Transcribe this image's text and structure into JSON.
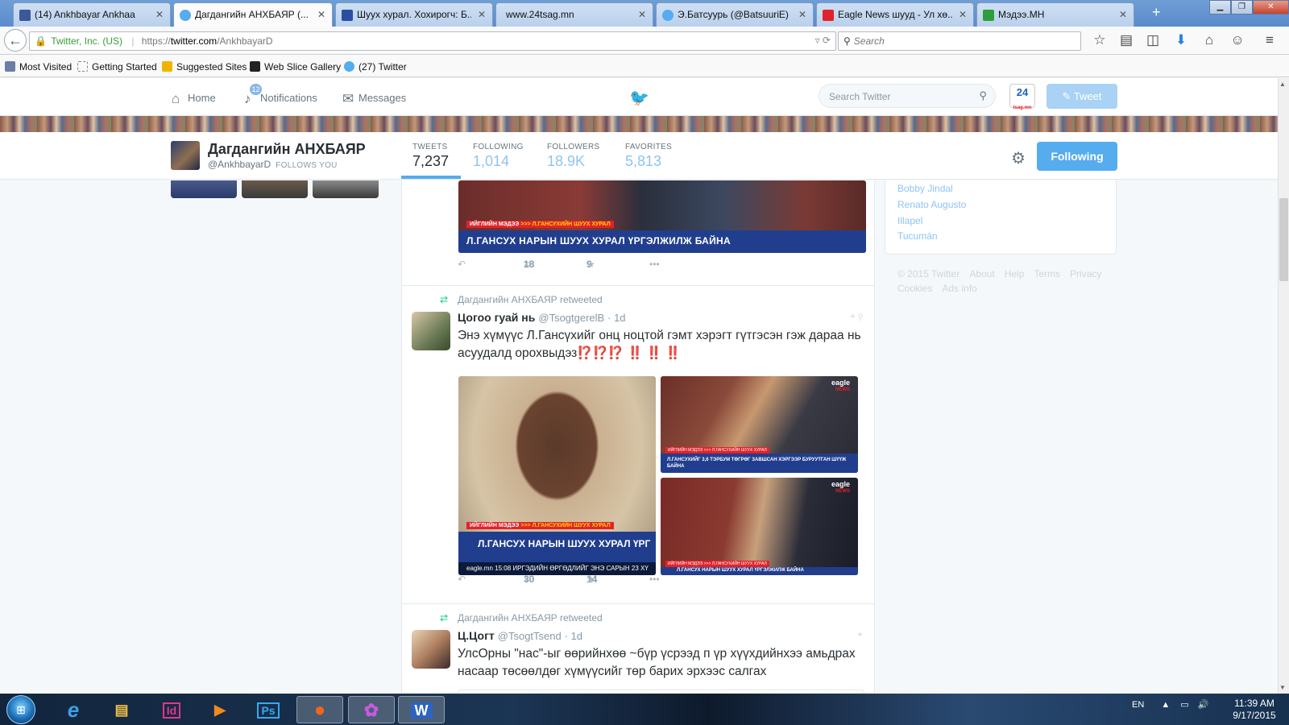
{
  "browser": {
    "tabs": [
      {
        "title": "(14) Ankhbayar Ankhaa",
        "color": "#3b5998"
      },
      {
        "title": "Дагдангийн АНХБАЯР (...",
        "color": "#55acee"
      },
      {
        "title": "Шуух хурал. Хохирогч: Б...",
        "color": "#2a4fa0"
      },
      {
        "title": "www.24tsag.mn",
        "color": "#ffffff"
      },
      {
        "title": "Э.Батсуурь (@BatsuuriE) ...",
        "color": "#55acee"
      },
      {
        "title": "Eagle News шууд - Ул хө...",
        "color": "#e2222a"
      },
      {
        "title": "Мэдээ.МН",
        "color": "#2e9e3c"
      }
    ],
    "url_identity": "Twitter, Inc. (US)",
    "url_prefix": "https://",
    "url_host": "twitter.com",
    "url_path": "/AnkhbayarD",
    "search_placeholder": "Search",
    "bookmarks": [
      {
        "label": "Most Visited",
        "color": "#6b7fa3"
      },
      {
        "label": "Getting Started",
        "color": "#ffffff"
      },
      {
        "label": "Suggested Sites",
        "color": "#f0b400"
      },
      {
        "label": "Web Slice Gallery",
        "color": "#222222"
      },
      {
        "label": "(27) Twitter",
        "color": "#55acee"
      }
    ]
  },
  "twitter_nav": {
    "home": "Home",
    "notifications": "Notifications",
    "notif_count": "12",
    "messages": "Messages",
    "search_placeholder": "Search Twitter",
    "tweet_button": "Tweet",
    "avatar_text": "24",
    "avatar_sub": "tsag.mn"
  },
  "profile": {
    "name": "Дагдангийн АНХБАЯР",
    "handle": "@AnkhbayarD",
    "follows_you": "FOLLOWS YOU",
    "stats": [
      {
        "label": "TWEETS",
        "value": "7,237"
      },
      {
        "label": "FOLLOWING",
        "value": "1,014"
      },
      {
        "label": "FOLLOWERS",
        "value": "18.9K"
      },
      {
        "label": "FAVORITES",
        "value": "5,813"
      }
    ],
    "following_button": "Following"
  },
  "timeline": {
    "tweet0": {
      "tag": "ИЙГЛИЙН МЭДЭЭ",
      "tag2": ">>> Л.ГАНСУХИЙН ШУУХ ХУРАЛ",
      "headline": "Л.ГАНСУХ НАРЫН ШУУХ ХУРАЛ ҮРГЭЛЖИЛЖ БАЙНА",
      "retweets": "18",
      "favorites": "9"
    },
    "tweet1": {
      "retweeted_by": "Дагдангийн АНХБАЯР retweeted",
      "name": "Цогоо гуай нь",
      "handle": "@TsogtgerelB",
      "time": "· 1d",
      "text": "Энэ хүмүүс Л.Гансүхийг онц ноцтой гэмт хэрэгт гүтгэсэн гэж дараа нь асуудалд орохвыдэз",
      "emphasis": "⁉️⁉️⁉️ ‼️ ‼️ ‼️",
      "img1_tag": "ИЙГЛИЙН МЭДЭЭ",
      "img1_tag2": ">>> Л.ГАНСУХИЙН ШУУХ ХУРАЛ",
      "img1_headline": "Л.ГАНСУХ НАРЫН ШУУХ ХУРАЛ ҮРГ",
      "img1_bottom": "eagle.mn  15:08  ИРГЭДИЙН ӨРГӨДЛИЙГ ЭНЭ САРЫН 23 ХҮ",
      "img2_tag": "ИЙГЛИЙН МЭДЭЭ >>> Л.ГАНСУХИЙН ШУУХ ХУРАЛ",
      "img2_headline": "Л.ГАНСУХИЙГ 3,6 ТЭРБУМ ТӨГРӨГ ЗАВШСАН ХЭРГЭЭР БУРУУТГАН ШҮҮЖ БАЙНА",
      "img3_tag": "ИЙГЛИЙН МЭДЭЭ >>> Л.ГАНСУХИЙН ШУУХ ХУРАЛ",
      "img3_headline": "Л.ГАНСУХ НАРЫН ШУУХ ХУРАЛ ҮРГЭЛЖИЛЖ БАЙНА",
      "eagle": "eagle",
      "eagle_sub": "NEWS",
      "retweets": "30",
      "favorites": "14"
    },
    "tweet2": {
      "retweeted_by": "Дагдангийн АНХБАЯР retweeted",
      "name": "Ц.Цогт",
      "handle": "@TsogtTsend",
      "time": "· 1d",
      "text": "УлсОрны \"нас\"-ыг өөрийнхөө ~бүр үсрээд п үр хүүхдийнхээ амьдрах насаар төсөөлдөг хүмүүсийг төр барих эрхээс салгах"
    }
  },
  "sidebar": {
    "trends": [
      "Bobby Jindal",
      "Renato Augusto",
      "Illapel",
      "Tucumán"
    ],
    "footer": [
      "© 2015 Twitter",
      "About",
      "Help",
      "Terms",
      "Privacy",
      "Cookies",
      "Ads info"
    ]
  },
  "taskbar": {
    "apps": [
      {
        "name": "internet-explorer",
        "glyph": "e",
        "color": "#3aa0e8"
      },
      {
        "name": "file-explorer",
        "glyph": "▤",
        "color": "#f1c24a"
      },
      {
        "name": "indesign",
        "glyph": "Id",
        "color": "#e0368c"
      },
      {
        "name": "media-player",
        "glyph": "▶",
        "color": "#f08a1c"
      },
      {
        "name": "photoshop",
        "glyph": "Ps",
        "color": "#36a9f0"
      },
      {
        "name": "firefox",
        "glyph": "●",
        "color": "#f0661c"
      },
      {
        "name": "messenger",
        "glyph": "✿",
        "color": "#c65be0"
      },
      {
        "name": "word",
        "glyph": "W",
        "color": "#2b64c2"
      }
    ],
    "lang": "EN",
    "time": "11:39 AM",
    "date": "9/17/2015"
  }
}
